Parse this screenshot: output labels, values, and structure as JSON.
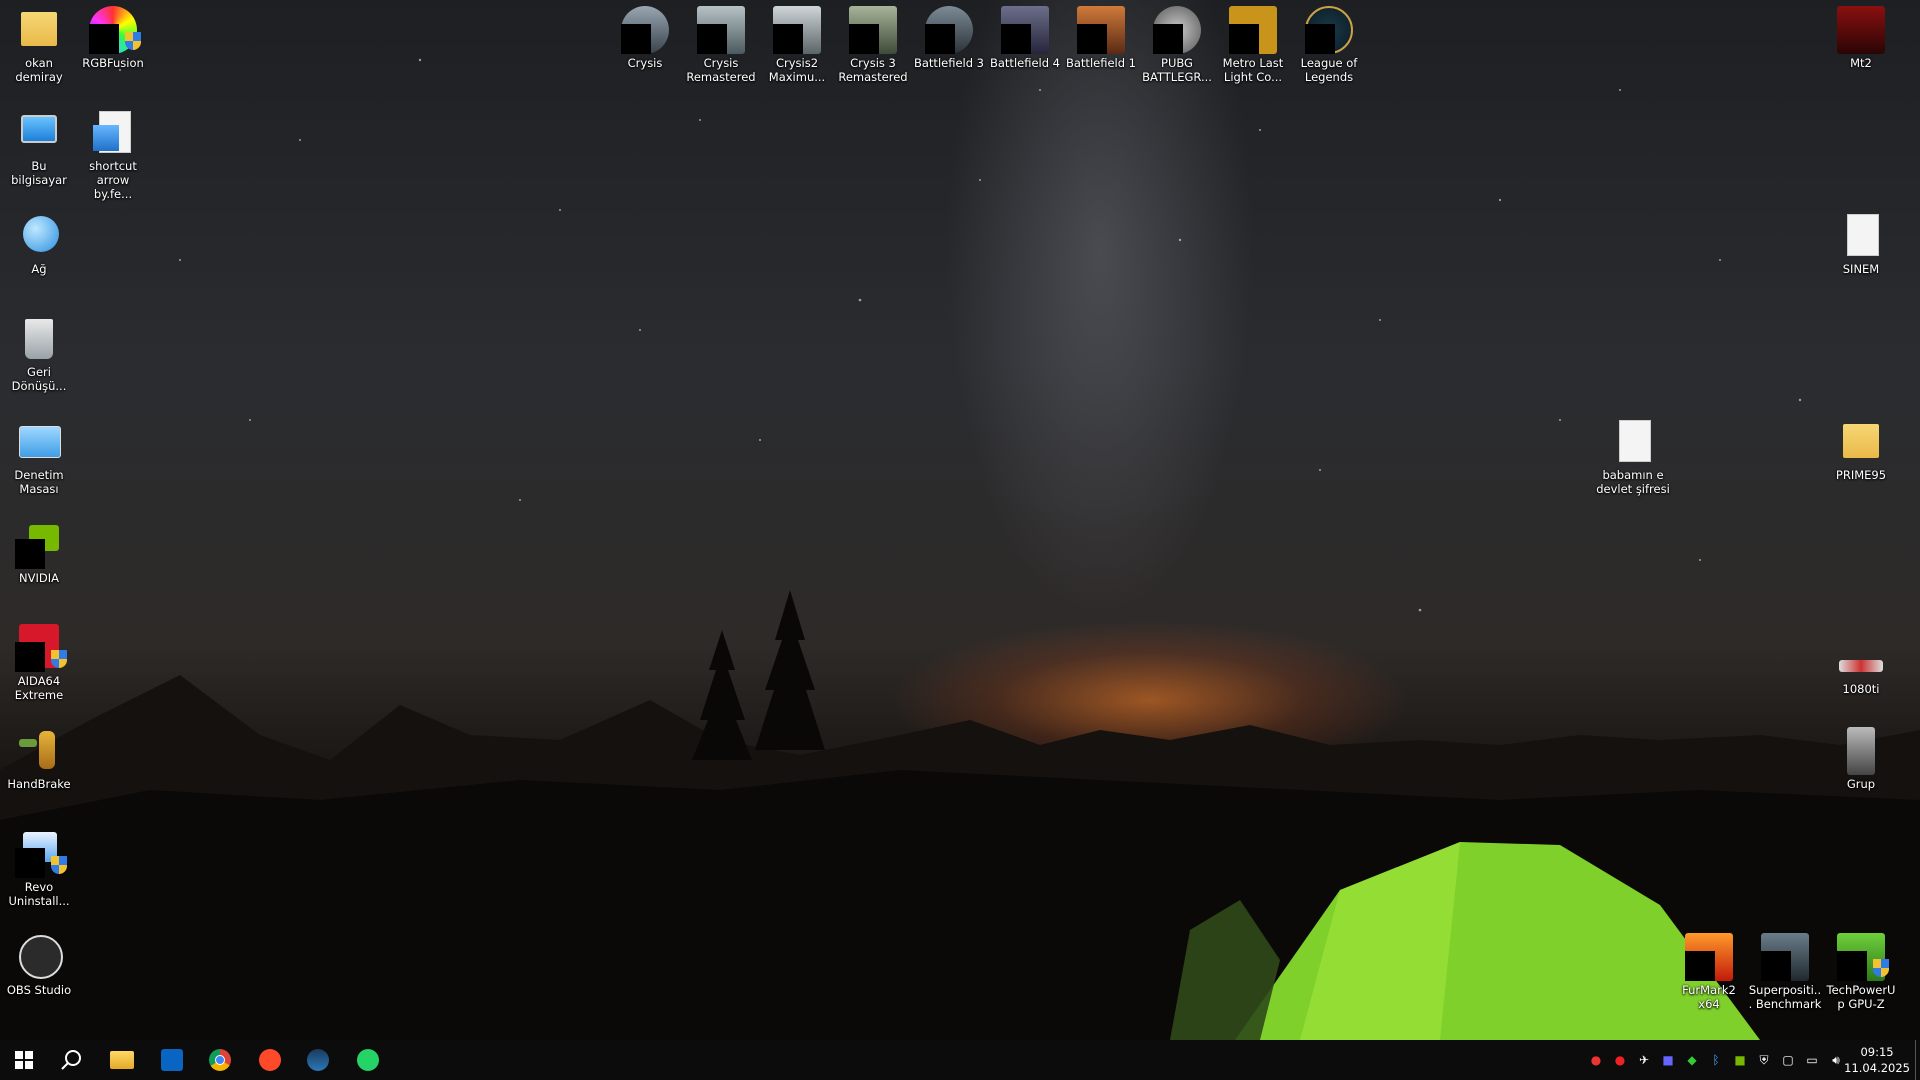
{
  "desktop": {
    "icons": {
      "okan": "okan demiray",
      "rgbfusion": "RGBFusion",
      "bu_bilgisayar": "Bu bilgisayar",
      "shortcut": "shortcut arrow by.fe...",
      "ag": "Ağ",
      "geri": "Geri Dönüşü...",
      "denetim": "Denetim Masası",
      "nvidia": "NVIDIA",
      "aida": "AIDA64 Extreme",
      "handbrake": "HandBrake",
      "revo": "Revo Uninstall...",
      "obs": "OBS Studio",
      "crysis": "Crysis",
      "crysis_rem": "Crysis Remastered",
      "crysis2": "Crysis2 Maximu...",
      "crysis3": "Crysis 3 Remastered",
      "bf3": "Battlefield 3",
      "bf4": "Battlefield 4",
      "bf1": "Battlefield 1",
      "pubg": "PUBG BATTLEGR...",
      "metro": "Metro Last Light Co...",
      "lol": "League of Legends",
      "mt2": "Mt2",
      "sinem": "SINEM",
      "babamin": "babamın e devlet şifresi",
      "prime95": "PRIME95",
      "gpu1080ti": "1080ti",
      "grup": "Grup",
      "furmark": "FurMark2 x64",
      "superposition": "Superpositi... Benchmark",
      "gpuz": "TechPowerUp GPU-Z"
    }
  },
  "taskbar": {
    "time": "09:15",
    "date": "11.04.2025"
  },
  "colors": {
    "taskbar_bg": "#0c0c0d",
    "tent": "#7fd02a",
    "horizon_glow": "#ff7a1e"
  }
}
